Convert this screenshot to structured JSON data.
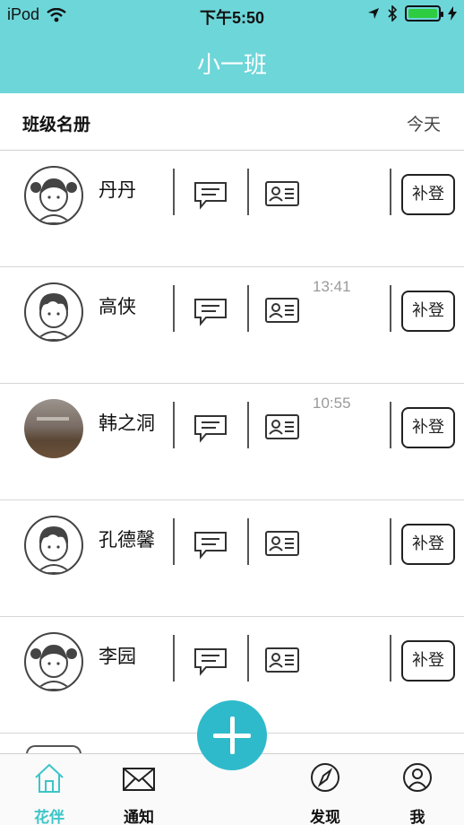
{
  "status_bar": {
    "carrier": "iPod",
    "time": "下午5:50"
  },
  "nav": {
    "title": "小一班"
  },
  "roster": {
    "label": "班级名册",
    "date_filter": "今天"
  },
  "students": [
    {
      "name": "丹丹",
      "avatar": "girl-avatar-icon",
      "time": "",
      "checkin_label": "补登"
    },
    {
      "name": "高侠",
      "avatar": "boy-avatar-icon",
      "time": "13:41",
      "checkin_label": "补登"
    },
    {
      "name": "韩之洞",
      "avatar": "photo-avatar",
      "time": "10:55",
      "checkin_label": "补登"
    },
    {
      "name": "孔德馨",
      "avatar": "boy-avatar-icon",
      "time": "",
      "checkin_label": "补登"
    },
    {
      "name": "李园",
      "avatar": "girl-avatar-icon",
      "time": "",
      "checkin_label": "补登"
    }
  ],
  "tabs": [
    {
      "label": "花伴",
      "icon": "home-icon",
      "active": true
    },
    {
      "label": "通知",
      "icon": "envelope-icon",
      "active": false
    },
    {
      "label": "发现",
      "icon": "compass-icon",
      "active": false
    },
    {
      "label": "我",
      "icon": "user-icon",
      "active": false
    }
  ],
  "colors": {
    "header": "#6dd6d9",
    "fab": "#2fbacb",
    "active_tab": "#3cc5c9"
  }
}
